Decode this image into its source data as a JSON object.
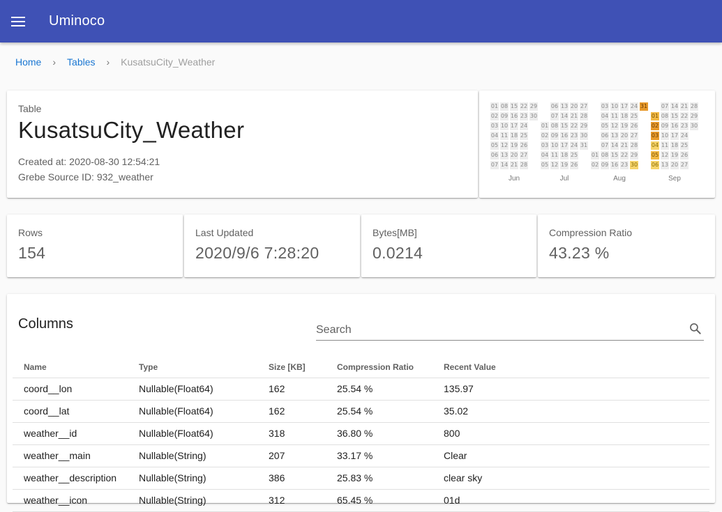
{
  "app": {
    "title": "Uminoco"
  },
  "breadcrumb": {
    "home": "Home",
    "tables": "Tables",
    "current": "KusatsuCity_Weather",
    "separator": "›"
  },
  "table_info": {
    "overline": "Table",
    "name": "KusatsuCity_Weather",
    "created": "Created at: 2020-08-30 12:54:21",
    "source": "Grebe Source ID: 932_weather"
  },
  "calendar": {
    "months": [
      {
        "label": "Jun",
        "rows": [
          [
            "01",
            "08",
            "15",
            "22",
            "29"
          ],
          [
            "02",
            "09",
            "16",
            "23",
            "30"
          ],
          [
            "03",
            "10",
            "17",
            "24",
            ""
          ],
          [
            "04",
            "11",
            "18",
            "25",
            ""
          ],
          [
            "05",
            "12",
            "19",
            "26",
            ""
          ],
          [
            "06",
            "13",
            "20",
            "27",
            ""
          ],
          [
            "07",
            "14",
            "21",
            "28",
            ""
          ]
        ]
      },
      {
        "label": "Jul",
        "rows": [
          [
            "",
            "06",
            "13",
            "20",
            "27"
          ],
          [
            "",
            "07",
            "14",
            "21",
            "28"
          ],
          [
            "01",
            "08",
            "15",
            "22",
            "29"
          ],
          [
            "02",
            "09",
            "16",
            "23",
            "30"
          ],
          [
            "03",
            "10",
            "17",
            "24",
            "31"
          ],
          [
            "04",
            "11",
            "18",
            "25",
            ""
          ],
          [
            "05",
            "12",
            "19",
            "26",
            ""
          ]
        ]
      },
      {
        "label": "Aug",
        "rows": [
          [
            "",
            "03",
            "10",
            "17",
            "24",
            "31"
          ],
          [
            "",
            "04",
            "11",
            "18",
            "25",
            ""
          ],
          [
            "",
            "05",
            "12",
            "19",
            "26",
            ""
          ],
          [
            "",
            "06",
            "13",
            "20",
            "27",
            ""
          ],
          [
            "",
            "07",
            "14",
            "21",
            "28",
            ""
          ],
          [
            "01",
            "08",
            "15",
            "22",
            "29",
            ""
          ],
          [
            "02",
            "09",
            "16",
            "23",
            "30",
            ""
          ]
        ]
      },
      {
        "label": "Sep",
        "rows": [
          [
            "",
            "07",
            "14",
            "21",
            "28"
          ],
          [
            "01",
            "08",
            "15",
            "22",
            "29"
          ],
          [
            "02",
            "09",
            "16",
            "23",
            "30"
          ],
          [
            "03",
            "10",
            "17",
            "24",
            ""
          ],
          [
            "04",
            "11",
            "18",
            "25",
            ""
          ],
          [
            "05",
            "12",
            "19",
            "26",
            ""
          ],
          [
            "06",
            "13",
            "20",
            "27",
            ""
          ]
        ]
      }
    ],
    "highlights": {
      "Aug-30": "light",
      "Aug-31": "dark",
      "Sep-01": "mid",
      "Sep-02": "dark",
      "Sep-03": "dark",
      "Sep-04": "light",
      "Sep-05": "mid",
      "Sep-06": "light"
    },
    "colors": {
      "light": "#f6d46c",
      "mid": "#f2b944",
      "dark": "#e89a2c",
      "empty": "#ececec"
    }
  },
  "stats": [
    {
      "label": "Rows",
      "value": "154"
    },
    {
      "label": "Last Updated",
      "value": "2020/9/6 7:28:20"
    },
    {
      "label": "Bytes[MB]",
      "value": "0.0214"
    },
    {
      "label": "Compression Ratio",
      "value": "43.23 %"
    }
  ],
  "columns": {
    "title": "Columns",
    "search_placeholder": "Search",
    "headers": [
      "Name",
      "Type",
      "Size [KB]",
      "Compression Ratio",
      "Recent Value"
    ],
    "rows": [
      [
        "coord__lon",
        "Nullable(Float64)",
        "162",
        "25.54 %",
        "135.97"
      ],
      [
        "coord__lat",
        "Nullable(Float64)",
        "162",
        "25.54 %",
        "35.02"
      ],
      [
        "weather__id",
        "Nullable(Float64)",
        "318",
        "36.80 %",
        "800"
      ],
      [
        "weather__main",
        "Nullable(String)",
        "207",
        "33.17 %",
        "Clear"
      ],
      [
        "weather__description",
        "Nullable(String)",
        "386",
        "25.83 %",
        "clear sky"
      ],
      [
        "weather__icon",
        "Nullable(String)",
        "312",
        "65.45 %",
        "01d"
      ]
    ]
  },
  "theme": {
    "primary": "#3f51b5",
    "link": "#1976d2"
  }
}
